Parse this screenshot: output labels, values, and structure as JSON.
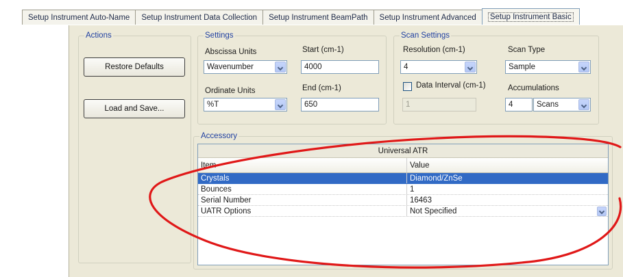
{
  "tabs": [
    {
      "label": "Setup Instrument Auto-Name"
    },
    {
      "label": "Setup Instrument Data Collection"
    },
    {
      "label": "Setup Instrument BeamPath"
    },
    {
      "label": "Setup Instrument Advanced"
    },
    {
      "label": "Setup Instrument Basic"
    }
  ],
  "actions": {
    "legend": "Actions",
    "restore_label": "Restore Defaults",
    "load_save_label": "Load and Save..."
  },
  "settings": {
    "legend": "Settings",
    "abscissa_label": "Abscissa Units",
    "abscissa_value": "Wavenumber",
    "start_label": "Start (cm-1)",
    "start_value": "4000",
    "ordinate_label": "Ordinate Units",
    "ordinate_value": "%T",
    "end_label": "End (cm-1)",
    "end_value": "650"
  },
  "scan_settings": {
    "legend": "Scan Settings",
    "resolution_label": "Resolution (cm-1)",
    "resolution_value": "4",
    "scan_type_label": "Scan Type",
    "scan_type_value": "Sample",
    "data_interval_label": "Data Interval (cm-1)",
    "data_interval_value": "1",
    "accumulations_label": "Accumulations",
    "accumulations_value": "4",
    "accumulations_unit": "Scans"
  },
  "accessory": {
    "legend": "Accessory",
    "title": "Universal ATR",
    "col_item": "Item",
    "col_value": "Value",
    "rows": [
      {
        "item": "Crystals",
        "value": "Diamond/ZnSe"
      },
      {
        "item": "Bounces",
        "value": "1"
      },
      {
        "item": "Serial Number",
        "value": "16463"
      },
      {
        "item": "UATR Options",
        "value": "Not Specified"
      }
    ]
  },
  "colors": {
    "selection": "#316ac5",
    "annotation": "#e01818",
    "legend_text": "#1f3fa0"
  }
}
